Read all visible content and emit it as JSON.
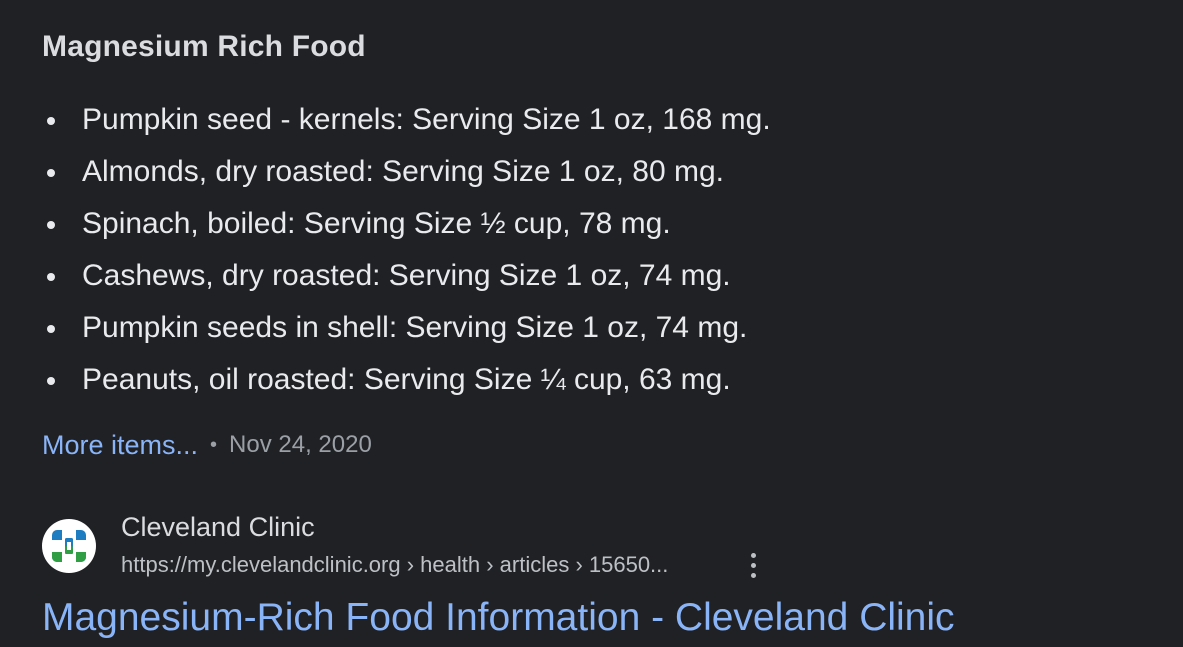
{
  "snippet": {
    "heading": "Magnesium Rich Food",
    "items": [
      "Pumpkin seed - kernels: Serving Size 1 oz, 168 mg.",
      "Almonds, dry roasted: Serving Size 1 oz, 80 mg.",
      "Spinach, boiled: Serving Size ½ cup, 78 mg.",
      "Cashews, dry roasted: Serving Size 1 oz, 74 mg.",
      "Pumpkin seeds in shell: Serving Size 1 oz, 74 mg.",
      "Peanuts, oil roasted: Serving Size ¼ cup, 63 mg."
    ],
    "more_items_label": "More items...",
    "separator": "•",
    "date": "Nov 24, 2020"
  },
  "result": {
    "favicon": "cleveland-clinic-logo",
    "site_name": "Cleveland Clinic",
    "url": "https://my.clevelandclinic.org › health › articles › 15650...",
    "title": "Magnesium-Rich Food Information - Cleveland Clinic"
  },
  "colors": {
    "background": "#202124",
    "link": "#8ab4f8",
    "text": "#e8eaed",
    "muted": "#9aa0a6",
    "logo_blue": "#1e7cc0",
    "logo_green": "#2f9e44"
  }
}
